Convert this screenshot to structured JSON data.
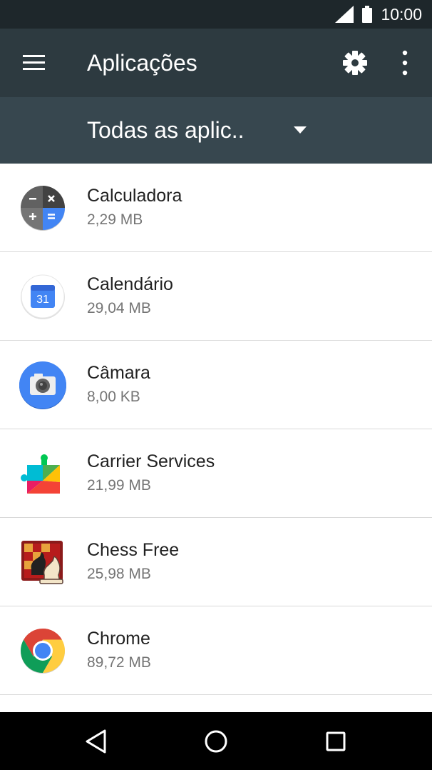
{
  "status_bar": {
    "time": "10:00",
    "icons": [
      "signal-icon",
      "battery-icon"
    ]
  },
  "app_bar": {
    "title": "Aplicações",
    "icons": [
      "menu-icon",
      "gear-icon",
      "more-vert-icon"
    ],
    "color": "#2d3a40"
  },
  "filter": {
    "selected": "Todas as aplic..",
    "color": "#37474f"
  },
  "apps": [
    {
      "name": "Calculadora",
      "size": "2,29 MB",
      "icon": "calculator-icon"
    },
    {
      "name": "Calendário",
      "size": "29,04 MB",
      "icon": "calendar-icon",
      "icon_text": "31"
    },
    {
      "name": "Câmara",
      "size": "8,00 KB",
      "icon": "camera-icon"
    },
    {
      "name": "Carrier Services",
      "size": "21,99 MB",
      "icon": "carrier-services-icon"
    },
    {
      "name": "Chess Free",
      "size": "25,98 MB",
      "icon": "chess-icon"
    },
    {
      "name": "Chrome",
      "size": "89,72 MB",
      "icon": "chrome-icon"
    }
  ],
  "nav_bar": {
    "buttons": [
      "back-icon",
      "home-icon",
      "recents-icon"
    ]
  }
}
